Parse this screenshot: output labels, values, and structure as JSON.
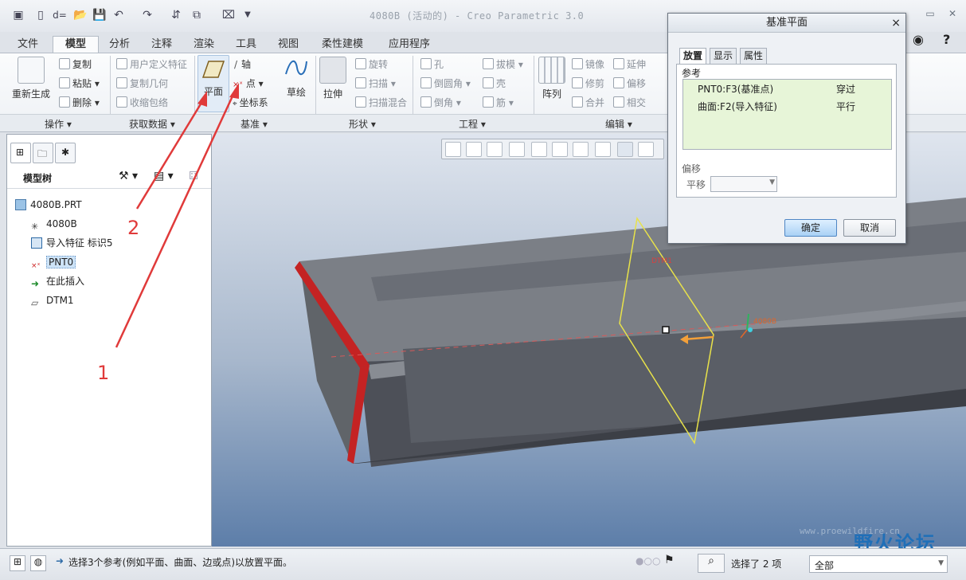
{
  "window": {
    "title": "4080B (活动的) - Creo Parametric 3.0"
  },
  "tabs": [
    "文件",
    "模型",
    "分析",
    "注释",
    "渲染",
    "工具",
    "视图",
    "柔性建模",
    "应用程序"
  ],
  "active_tab": "模型",
  "ribbon": {
    "regen": "重新生成",
    "ops": [
      "复制",
      "粘贴",
      "删除"
    ],
    "get_data": [
      "用户定义特征",
      "复制几何",
      "收缩包络"
    ],
    "plane": "平面",
    "axis": "轴",
    "point": "点",
    "csys": "坐标系",
    "sketch": "草绘",
    "extrude": "拉伸",
    "shape": [
      "旋转",
      "扫描",
      "扫描混合"
    ],
    "eng1": [
      "孔",
      "倒圆角",
      "倒角"
    ],
    "eng2": [
      "拔模",
      "壳",
      "筋"
    ],
    "pattern": "阵列",
    "edit1": [
      "镜像",
      "修剪",
      "合并"
    ],
    "edit2": [
      "延伸",
      "偏移",
      "相交"
    ],
    "groups": [
      "操作",
      "获取数据",
      "基准",
      "形状",
      "工程",
      "编辑"
    ]
  },
  "tree": {
    "title": "模型树",
    "items": [
      "4080B.PRT",
      "4080B",
      "导入特征 标识5",
      "PNT0",
      "在此插入",
      "DTM1"
    ]
  },
  "dialog": {
    "title": "基准平面",
    "tabs": [
      "放置",
      "显示",
      "属性"
    ],
    "ref_label": "参考",
    "refs": [
      {
        "name": "PNT0:F3(基准点)",
        "type": "穿过"
      },
      {
        "name": "曲面:F2(导入特征)",
        "type": "平行"
      }
    ],
    "offset_label": "偏移",
    "translate_label": "平移",
    "ok": "确定",
    "cancel": "取消"
  },
  "status": {
    "message": "选择3个参考(例如平面、曲面、边或点)以放置平面。",
    "selected": "选择了 2 项",
    "filter": "全部"
  },
  "viewport": {
    "plane_tag": "DTM1",
    "csys_tag": "4080B"
  },
  "annotations": [
    "1",
    "2"
  ],
  "watermark": {
    "name": "野火论坛",
    "url": "www.proewildfire.cn"
  },
  "colors": {
    "accent": "#e03a3a",
    "selection": "#cde3f7",
    "ref_bg": "#e7f5d8"
  }
}
